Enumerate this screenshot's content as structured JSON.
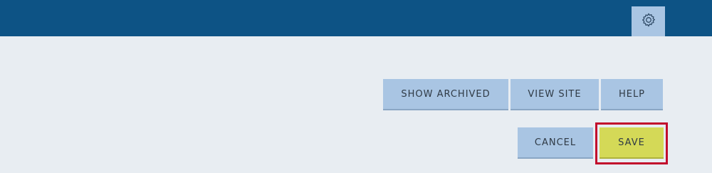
{
  "header": {
    "settings_icon": "gear-icon",
    "background": "#0d5385"
  },
  "toolbar": {
    "show_archived_label": "SHOW ARCHIVED",
    "view_site_label": "VIEW SITE",
    "help_label": "HELP"
  },
  "actions": {
    "cancel_label": "CANCEL",
    "save_label": "SAVE",
    "save_highlight_color": "#c20d2c",
    "save_color": "#d4d957",
    "button_color": "#a9c5e3"
  }
}
